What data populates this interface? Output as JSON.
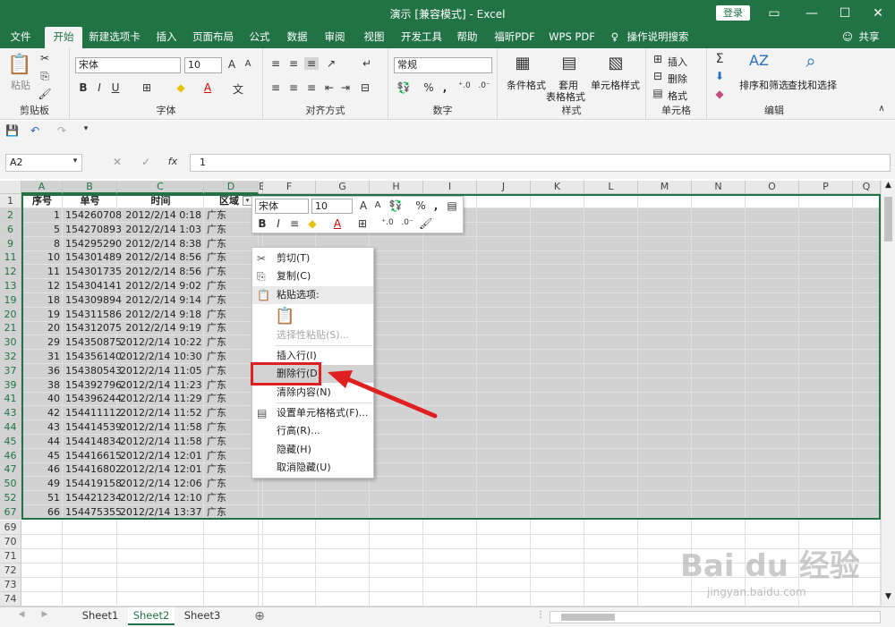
{
  "window": {
    "title": "演示 [兼容模式] - Excel",
    "login": "登录",
    "share": "共享"
  },
  "tabs": [
    "文件",
    "开始",
    "新建选项卡",
    "插入",
    "页面布局",
    "公式",
    "数据",
    "审阅",
    "视图",
    "开发工具",
    "帮助",
    "福昕PDF",
    "WPS PDF",
    "操作说明搜索"
  ],
  "ribbon": {
    "clipboard": {
      "paste": "粘贴",
      "label": "剪贴板"
    },
    "font": {
      "name": "宋体",
      "size": "10",
      "label": "字体",
      "bold": "B",
      "italic": "I",
      "underline": "U"
    },
    "align": {
      "label": "对齐方式"
    },
    "number": {
      "format": "常规",
      "label": "数字",
      "percent": "%",
      "comma": ","
    },
    "styles": {
      "cond": "条件格式",
      "table1": "套用",
      "table2": "表格格式",
      "cell": "单元格样式",
      "label": "样式"
    },
    "cells": {
      "insert": "插入",
      "delete": "删除",
      "format": "格式",
      "label": "单元格"
    },
    "edit": {
      "sort": "排序和筛选",
      "find": "查找和选择",
      "label": "编辑"
    }
  },
  "formula_bar": {
    "namebox": "A2",
    "fx": "fx",
    "value": "1"
  },
  "columns": [
    "A",
    "B",
    "C",
    "D",
    "E",
    "F",
    "G",
    "H",
    "I",
    "J",
    "K",
    "L",
    "M",
    "N",
    "O",
    "P",
    "Q"
  ],
  "header_row": {
    "num": "1",
    "a": "序号",
    "b": "单号",
    "c": "时间",
    "d": "区域"
  },
  "rows": [
    {
      "r": "2",
      "a": "1",
      "b": "154260708",
      "c": "2012/2/14 0:18",
      "d": "广东"
    },
    {
      "r": "6",
      "a": "5",
      "b": "154270893",
      "c": "2012/2/14 1:03",
      "d": "广东"
    },
    {
      "r": "9",
      "a": "8",
      "b": "154295290",
      "c": "2012/2/14 8:38",
      "d": "广东"
    },
    {
      "r": "11",
      "a": "10",
      "b": "154301489",
      "c": "2012/2/14 8:56",
      "d": "广东"
    },
    {
      "r": "12",
      "a": "11",
      "b": "154301735",
      "c": "2012/2/14 8:56",
      "d": "广东"
    },
    {
      "r": "13",
      "a": "12",
      "b": "154304141",
      "c": "2012/2/14 9:02",
      "d": "广东"
    },
    {
      "r": "19",
      "a": "18",
      "b": "154309894",
      "c": "2012/2/14 9:14",
      "d": "广东"
    },
    {
      "r": "20",
      "a": "19",
      "b": "154311586",
      "c": "2012/2/14 9:18",
      "d": "广东"
    },
    {
      "r": "21",
      "a": "20",
      "b": "154312075",
      "c": "2012/2/14 9:19",
      "d": "广东"
    },
    {
      "r": "30",
      "a": "29",
      "b": "154350875",
      "c": "2012/2/14 10:22",
      "d": "广东"
    },
    {
      "r": "32",
      "a": "31",
      "b": "154356140",
      "c": "2012/2/14 10:30",
      "d": "广东"
    },
    {
      "r": "37",
      "a": "36",
      "b": "154380543",
      "c": "2012/2/14 11:05",
      "d": "广东"
    },
    {
      "r": "39",
      "a": "38",
      "b": "154392796",
      "c": "2012/2/14 11:23",
      "d": "广东"
    },
    {
      "r": "41",
      "a": "40",
      "b": "154396244",
      "c": "2012/2/14 11:29",
      "d": "广东"
    },
    {
      "r": "43",
      "a": "42",
      "b": "154411112",
      "c": "2012/2/14 11:52",
      "d": "广东"
    },
    {
      "r": "44",
      "a": "43",
      "b": "154414539",
      "c": "2012/2/14 11:58",
      "d": "广东"
    },
    {
      "r": "45",
      "a": "44",
      "b": "154414834",
      "c": "2012/2/14 11:58",
      "d": "广东"
    },
    {
      "r": "46",
      "a": "45",
      "b": "154416615",
      "c": "2012/2/14 12:01",
      "d": "广东"
    },
    {
      "r": "47",
      "a": "46",
      "b": "154416802",
      "c": "2012/2/14 12:01",
      "d": "广东"
    },
    {
      "r": "50",
      "a": "49",
      "b": "154419158",
      "c": "2012/2/14 12:06",
      "d": "广东"
    },
    {
      "r": "52",
      "a": "51",
      "b": "154421234",
      "c": "2012/2/14 12:10",
      "d": "广东"
    },
    {
      "r": "67",
      "a": "66",
      "b": "154475355",
      "c": "2012/2/14 13:37",
      "d": "广东"
    }
  ],
  "empty_rows": [
    "69",
    "70",
    "71",
    "72",
    "73",
    "74"
  ],
  "mini_toolbar": {
    "font": "宋体",
    "size": "10"
  },
  "context_menu": [
    "剪切(T)",
    "复制(C)",
    "粘贴选项:",
    "选择性粘贴(S)...",
    "插入行(I)",
    "删除行(D)",
    "清除内容(N)",
    "设置单元格格式(F)...",
    "行高(R)...",
    "隐藏(H)",
    "取消隐藏(U)"
  ],
  "sheets": [
    "Sheet1",
    "Sheet2",
    "Sheet3"
  ],
  "watermark": {
    "main": "Bai du 经验",
    "sub": "jingyan.baidu.com"
  },
  "colors": {
    "excel_green": "#217346",
    "highlight": "#e02020"
  }
}
